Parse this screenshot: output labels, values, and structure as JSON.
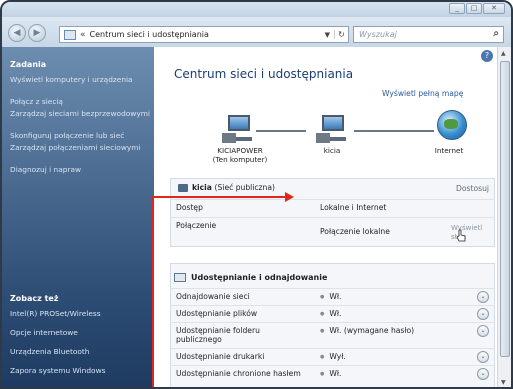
{
  "window": {
    "address_path": "Centrum sieci i udostępniania",
    "search_placeholder": "Wyszukaj"
  },
  "sidebar": {
    "tasks_heading": "Zadania",
    "tasks": [
      "Wyświetl komputery i urządzenia",
      "Połącz z siecią",
      "Zarządzaj sieciami bezprzewodowymi",
      "Skonfiguruj połączenie lub sieć",
      "Zarządzaj połączeniami sieciowymi",
      "Diagnozuj i napraw"
    ],
    "see_also_heading": "Zobacz też",
    "see_also": [
      "Intel(R) PROSet/Wireless",
      "Opcje internetowe",
      "Urządzenia Bluetooth",
      "Zapora systemu Windows"
    ]
  },
  "main": {
    "title": "Centrum sieci i udostępniania",
    "full_map_link": "Wyświetl pełną mapę",
    "map_nodes": [
      {
        "label": "KICIAPOWER",
        "sublabel": "(Ten komputer)"
      },
      {
        "label": "kicia"
      },
      {
        "label": "Internet"
      }
    ],
    "network": {
      "name": "kicia",
      "type": "(Sieć publiczna)",
      "customize": "Dostosuj",
      "rows": [
        {
          "key": "Dostęp",
          "value": "Lokalne i Internet"
        },
        {
          "key": "Połączenie",
          "value": "Połączenie lokalne"
        }
      ],
      "view_status_line1": "Wyświetl",
      "view_status_line2": "stan"
    },
    "sharing": {
      "heading": "Udostępnianie i odnajdowanie",
      "rows": [
        {
          "key": "Odnajdowanie sieci",
          "value": "Wł."
        },
        {
          "key": "Udostępnianie plików",
          "value": "Wł."
        },
        {
          "key": "Udostępnianie folderu publicznego",
          "value": "Wł. (wymagane hasło)"
        },
        {
          "key": "Udostępnianie drukarki",
          "value": "Wył."
        },
        {
          "key": "Udostępnianie chronione hasłem",
          "value": "Wł."
        }
      ]
    }
  }
}
